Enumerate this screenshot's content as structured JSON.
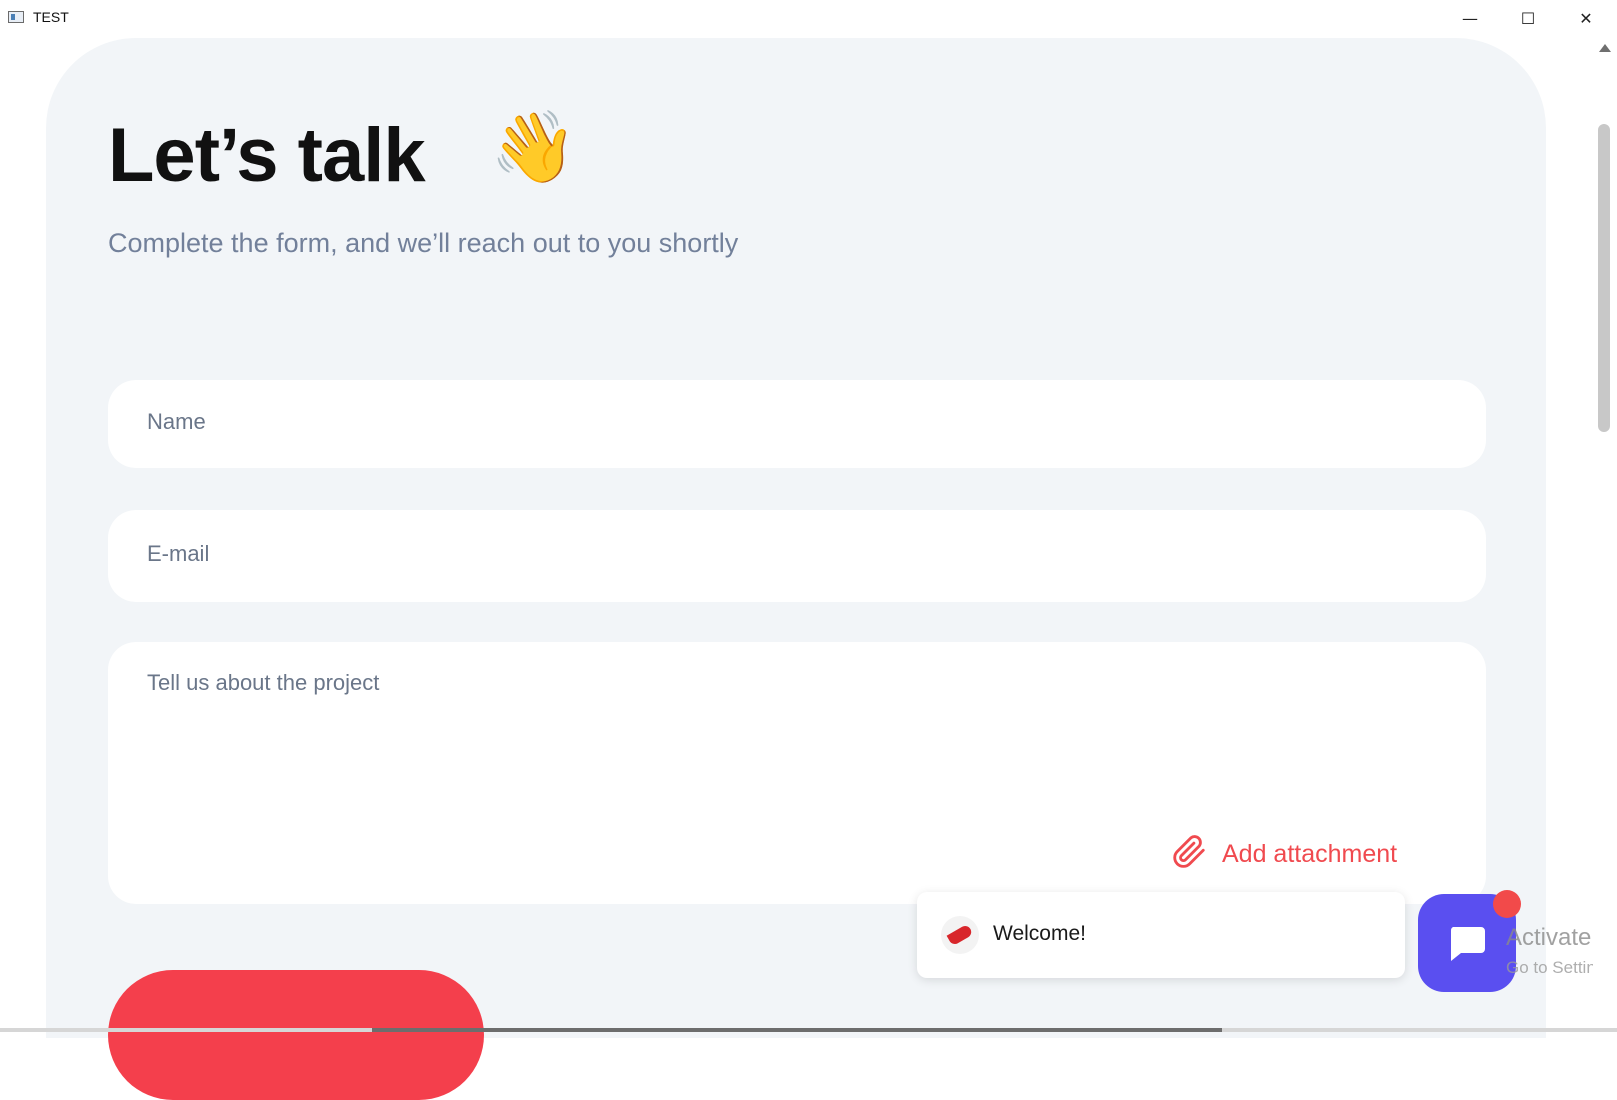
{
  "window": {
    "title": "TEST",
    "minimize": "—",
    "maximize": "☐",
    "close": "✕"
  },
  "form": {
    "heading": "Let’s talk",
    "heading_emoji": "👋",
    "subtitle": "Complete the form, and we’ll reach out to you shortly",
    "name_placeholder": "Name",
    "email_placeholder": "E-mail",
    "message_placeholder": "Tell us about the project",
    "attachment_label": "Add attachment"
  },
  "chat": {
    "welcome": "Welcome!"
  },
  "os_overlay": {
    "activate": "Activate W",
    "settings": "Go to Settings"
  },
  "colors": {
    "accent": "#f43f4c",
    "chat": "#5a4ff0",
    "background": "#f2f5f8"
  }
}
